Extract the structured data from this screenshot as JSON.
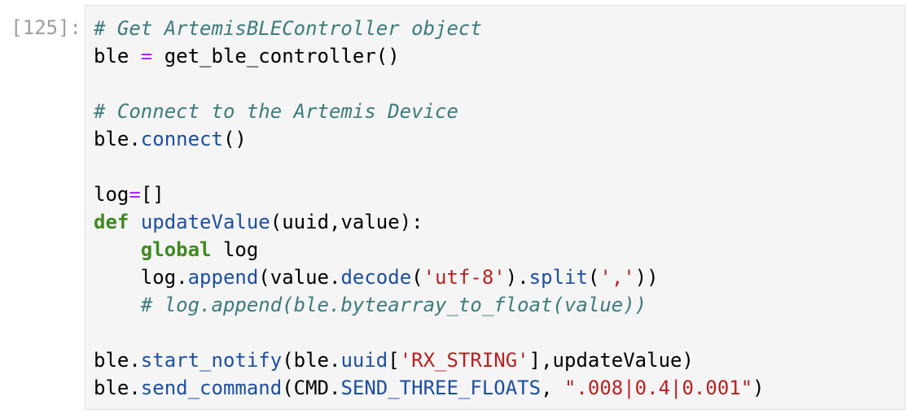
{
  "cell": {
    "prompt": "[125]:"
  },
  "colors": {
    "comment": "#3d7b7b",
    "keyword": "#3e8a1f",
    "operator": "#aa22ff",
    "function": "#1c4fa0",
    "string": "#ba2121",
    "prompt": "#9e9e9e",
    "editor_background": "#f5f5f5"
  },
  "code": {
    "l1": {
      "comment": "# Get ArtemisBLEController object"
    },
    "l2": {
      "a": "ble ",
      "op": "=",
      "b": " get_ble_controller()"
    },
    "l4": {
      "comment": "# Connect to the Artemis Device"
    },
    "l5": {
      "a": "ble.",
      "fn": "connect",
      "b": "()"
    },
    "l7": {
      "a": "log",
      "op": "=",
      "b": "[]"
    },
    "l8": {
      "kw": "def",
      "sp": " ",
      "fn": "updateValue",
      "b": "(uuid,value):"
    },
    "l9": {
      "indent": "    ",
      "kw": "global",
      "b": " log"
    },
    "l10": {
      "indent": "    ",
      "a": "log.",
      "fn1": "append",
      "b": "(value.",
      "fn2": "decode",
      "c": "(",
      "s1": "'utf-8'",
      "d": ").",
      "fn3": "split",
      "e": "(",
      "s2": "','",
      "f": "))"
    },
    "l11": {
      "indent": "    ",
      "comment": "# log.append(ble.bytearray_to_float(value))"
    },
    "l13": {
      "a": "ble.",
      "fn1": "start_notify",
      "b": "(ble.",
      "fn2": "uuid",
      "c": "[",
      "s1": "'RX_STRING'",
      "d": "],updateValue)"
    },
    "l14": {
      "a": "ble.",
      "fn1": "send_command",
      "b": "(CMD.",
      "fn2": "SEND_THREE_FLOATS",
      "c": ", ",
      "s1": "\".008|0.4|0.001\"",
      "d": ")"
    }
  }
}
